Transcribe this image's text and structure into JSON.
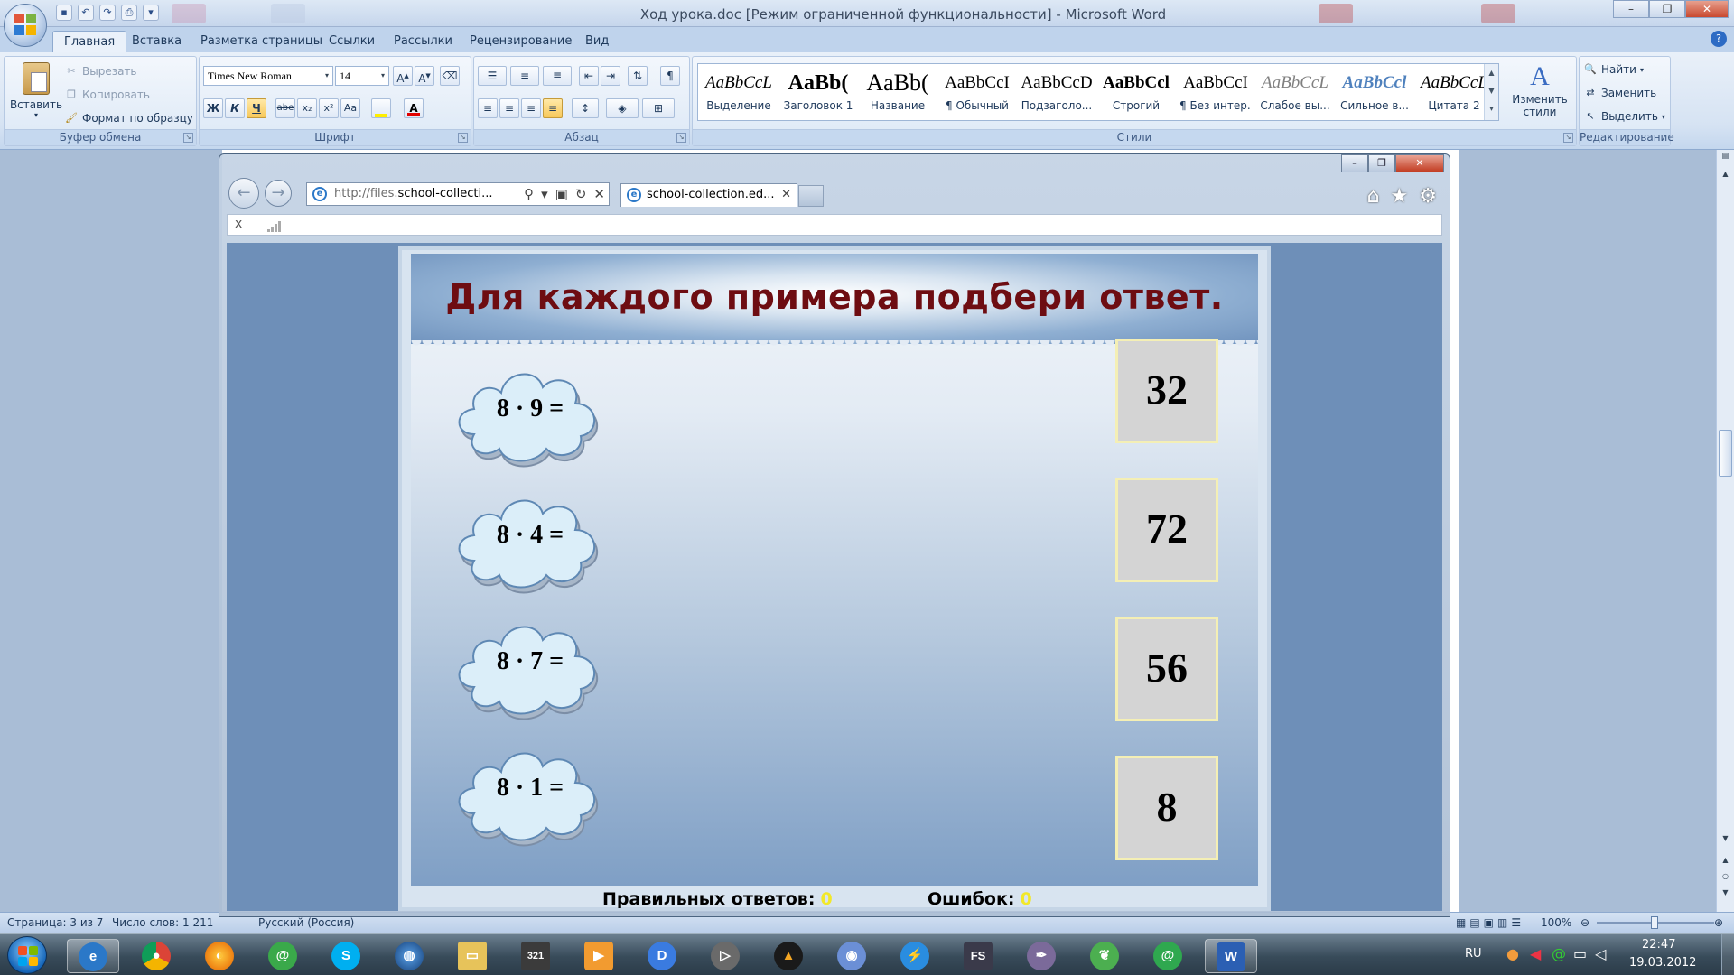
{
  "word": {
    "title": "Ход урока.doc [Режим ограниченной функциональности] - Microsoft Word",
    "tabs": [
      "Главная",
      "Вставка",
      "Разметка страницы",
      "Ссылки",
      "Рассылки",
      "Рецензирование",
      "Вид"
    ],
    "clipboard": {
      "paste": "Вставить",
      "cut": "Вырезать",
      "copy": "Копировать",
      "format_painter": "Формат по образцу",
      "label": "Буфер обмена"
    },
    "font": {
      "name": "Times New Roman",
      "size": "14",
      "label": "Шрифт",
      "bold": "Ж",
      "italic": "К",
      "underline": "Ч",
      "strike": "abe",
      "sub": "x₂",
      "sup": "x²",
      "case": "Aa"
    },
    "paragraph": {
      "label": "Абзац"
    },
    "styles": {
      "label": "Стили",
      "items": [
        {
          "sample": "AaBbCcL",
          "name": "Выделение"
        },
        {
          "sample": "AaBb(",
          "name": "Заголовок 1"
        },
        {
          "sample": "AaBb(",
          "name": "Название"
        },
        {
          "sample": "AaBbCcI",
          "name": "¶ Обычный"
        },
        {
          "sample": "AaBbCcD",
          "name": "Подзаголо..."
        },
        {
          "sample": "AaBbCcl",
          "name": "Строгий"
        },
        {
          "sample": "AaBbCcI",
          "name": "¶ Без интер..."
        },
        {
          "sample": "AaBbCcL",
          "name": "Слабое вы..."
        },
        {
          "sample": "AaBbCcl",
          "name": "Сильное в..."
        },
        {
          "sample": "AaBbCcL",
          "name": "Цитата 2"
        }
      ],
      "change": "Изменить стили"
    },
    "editing": {
      "label": "Редактирование",
      "find": "Найти",
      "replace": "Заменить",
      "select": "Выделить"
    },
    "status": {
      "page": "Страница: 3 из 7",
      "words": "Число слов: 1 211",
      "lang": "Русский (Россия)",
      "zoom": "100%"
    }
  },
  "browser": {
    "url_prefix": "http://files.",
    "url_domain": "school-collecti...",
    "tab_title": "school-collection.ed...",
    "addon_close": "x"
  },
  "exercise": {
    "title": "Для каждого примера подбери ответ.",
    "examples": [
      "8 · 9 =",
      "8 · 4 =",
      "8 · 7 =",
      "8 · 1 ="
    ],
    "answers": [
      "32",
      "72",
      "56",
      "8"
    ],
    "correct_label": "Правильных ответов:",
    "correct_value": "0",
    "errors_label": "Ошибок:",
    "errors_value": "0"
  },
  "tray": {
    "lang": "RU",
    "time": "22:47",
    "date": "19.03.2012"
  },
  "taskbar_apps": [
    "Internet Explorer",
    "Chrome",
    "Firefox",
    "Mail.Ru Agent",
    "Skype",
    "Earth",
    "Folder",
    "Media Player Classic",
    "Player",
    "Media",
    "Player",
    "Daemon Tools",
    "Program",
    "Download",
    "FS",
    "Pen",
    "Butterfly",
    "ICQ",
    "Word"
  ]
}
